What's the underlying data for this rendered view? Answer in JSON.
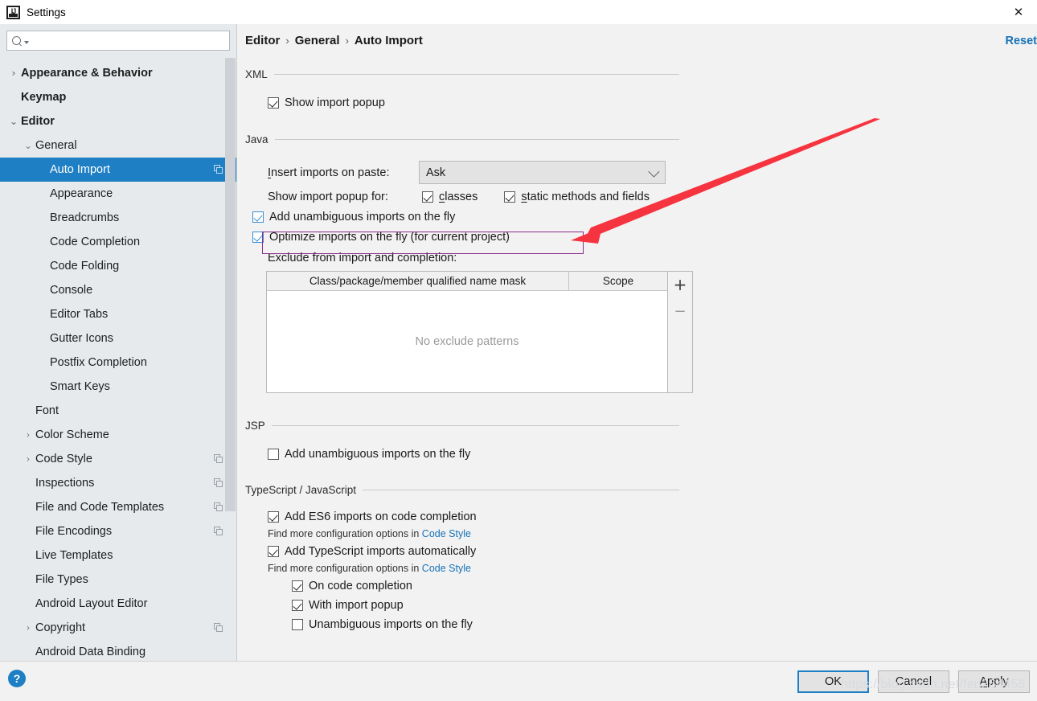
{
  "window": {
    "title": "Settings",
    "app_icon": "intellij-idea-icon",
    "close_icon": "✕"
  },
  "sidebar": {
    "search": {
      "value": "",
      "placeholder": "",
      "icon": "search-icon"
    },
    "items": [
      {
        "label": "Appearance & Behavior",
        "depth": 0,
        "arrow": "›",
        "bold": true,
        "selected": false,
        "copy": false
      },
      {
        "label": "Keymap",
        "depth": 0,
        "arrow": "",
        "bold": true,
        "selected": false,
        "copy": false
      },
      {
        "label": "Editor",
        "depth": 0,
        "arrow": "⌄",
        "bold": true,
        "selected": false,
        "copy": false
      },
      {
        "label": "General",
        "depth": 1,
        "arrow": "⌄",
        "bold": false,
        "selected": false,
        "copy": false
      },
      {
        "label": "Auto Import",
        "depth": 2,
        "arrow": "",
        "bold": false,
        "selected": true,
        "copy": true
      },
      {
        "label": "Appearance",
        "depth": 2,
        "arrow": "",
        "bold": false,
        "selected": false,
        "copy": false
      },
      {
        "label": "Breadcrumbs",
        "depth": 2,
        "arrow": "",
        "bold": false,
        "selected": false,
        "copy": false
      },
      {
        "label": "Code Completion",
        "depth": 2,
        "arrow": "",
        "bold": false,
        "selected": false,
        "copy": false
      },
      {
        "label": "Code Folding",
        "depth": 2,
        "arrow": "",
        "bold": false,
        "selected": false,
        "copy": false
      },
      {
        "label": "Console",
        "depth": 2,
        "arrow": "",
        "bold": false,
        "selected": false,
        "copy": false
      },
      {
        "label": "Editor Tabs",
        "depth": 2,
        "arrow": "",
        "bold": false,
        "selected": false,
        "copy": false
      },
      {
        "label": "Gutter Icons",
        "depth": 2,
        "arrow": "",
        "bold": false,
        "selected": false,
        "copy": false
      },
      {
        "label": "Postfix Completion",
        "depth": 2,
        "arrow": "",
        "bold": false,
        "selected": false,
        "copy": false
      },
      {
        "label": "Smart Keys",
        "depth": 2,
        "arrow": "",
        "bold": false,
        "selected": false,
        "copy": false
      },
      {
        "label": "Font",
        "depth": 1,
        "arrow": "",
        "bold": false,
        "selected": false,
        "copy": false
      },
      {
        "label": "Color Scheme",
        "depth": 1,
        "arrow": "›",
        "bold": false,
        "selected": false,
        "copy": false
      },
      {
        "label": "Code Style",
        "depth": 1,
        "arrow": "›",
        "bold": false,
        "selected": false,
        "copy": true
      },
      {
        "label": "Inspections",
        "depth": 1,
        "arrow": "",
        "bold": false,
        "selected": false,
        "copy": true
      },
      {
        "label": "File and Code Templates",
        "depth": 1,
        "arrow": "",
        "bold": false,
        "selected": false,
        "copy": true
      },
      {
        "label": "File Encodings",
        "depth": 1,
        "arrow": "",
        "bold": false,
        "selected": false,
        "copy": true
      },
      {
        "label": "Live Templates",
        "depth": 1,
        "arrow": "",
        "bold": false,
        "selected": false,
        "copy": false
      },
      {
        "label": "File Types",
        "depth": 1,
        "arrow": "",
        "bold": false,
        "selected": false,
        "copy": false
      },
      {
        "label": "Android Layout Editor",
        "depth": 1,
        "arrow": "",
        "bold": false,
        "selected": false,
        "copy": false
      },
      {
        "label": "Copyright",
        "depth": 1,
        "arrow": "›",
        "bold": false,
        "selected": false,
        "copy": true
      },
      {
        "label": "Android Data Binding",
        "depth": 1,
        "arrow": "",
        "bold": false,
        "selected": false,
        "copy": false
      }
    ]
  },
  "main": {
    "breadcrumb": [
      "Editor",
      "General",
      "Auto Import"
    ],
    "breadcrumb_separator": "›",
    "reset_label": "Reset",
    "sections": {
      "xml": {
        "title": "XML",
        "show_import_popup": {
          "label": "Show import popup",
          "checked": true
        }
      },
      "java": {
        "title": "Java",
        "insert_imports_label": "Insert imports on paste:",
        "insert_imports_value": "Ask",
        "show_popup_for_label": "Show import popup for:",
        "classes": {
          "label": "classes",
          "checked": true
        },
        "static_methods": {
          "label": "static methods and fields",
          "checked": true
        },
        "add_unambiguous": {
          "label": "Add unambiguous imports on the fly",
          "checked": true
        },
        "optimize_imports": {
          "label": "Optimize imports on the fly (for current project)",
          "checked": true
        },
        "exclude_label": "Exclude from import and completion:",
        "table": {
          "columns": [
            "Class/package/member qualified name mask",
            "Scope"
          ],
          "rows": [],
          "empty_text": "No exclude patterns",
          "add_label": "+",
          "remove_label": "−"
        }
      },
      "jsp": {
        "title": "JSP",
        "add_unambiguous": {
          "label": "Add unambiguous imports on the fly",
          "checked": false
        }
      },
      "ts": {
        "title": "TypeScript / JavaScript",
        "es6": {
          "label": "Add ES6 imports on code completion",
          "checked": true
        },
        "hint1_pre": "Find more configuration options in",
        "hint1_link": "Code Style",
        "auto_ts": {
          "label": "Add TypeScript imports automatically",
          "checked": true
        },
        "hint2_pre": "Find more configuration options in",
        "hint2_link": "Code Style",
        "on_code_completion": {
          "label": "On code completion",
          "checked": true
        },
        "with_import_popup": {
          "label": "With import popup",
          "checked": true
        },
        "unambiguous_fly": {
          "label": "Unambiguous imports on the fly",
          "checked": false
        }
      }
    }
  },
  "footer": {
    "help_label": "?",
    "ok_label": "OK",
    "cancel_label": "Cancel",
    "apply_label": "Apply"
  },
  "annotations": {
    "watermark": "https://blog.csdn.net/fen264456",
    "arrow_color": "#f63440",
    "highlight_color": "#8b2d8b",
    "accent_color": "#1f7fc4",
    "link_color": "#1572b8"
  }
}
